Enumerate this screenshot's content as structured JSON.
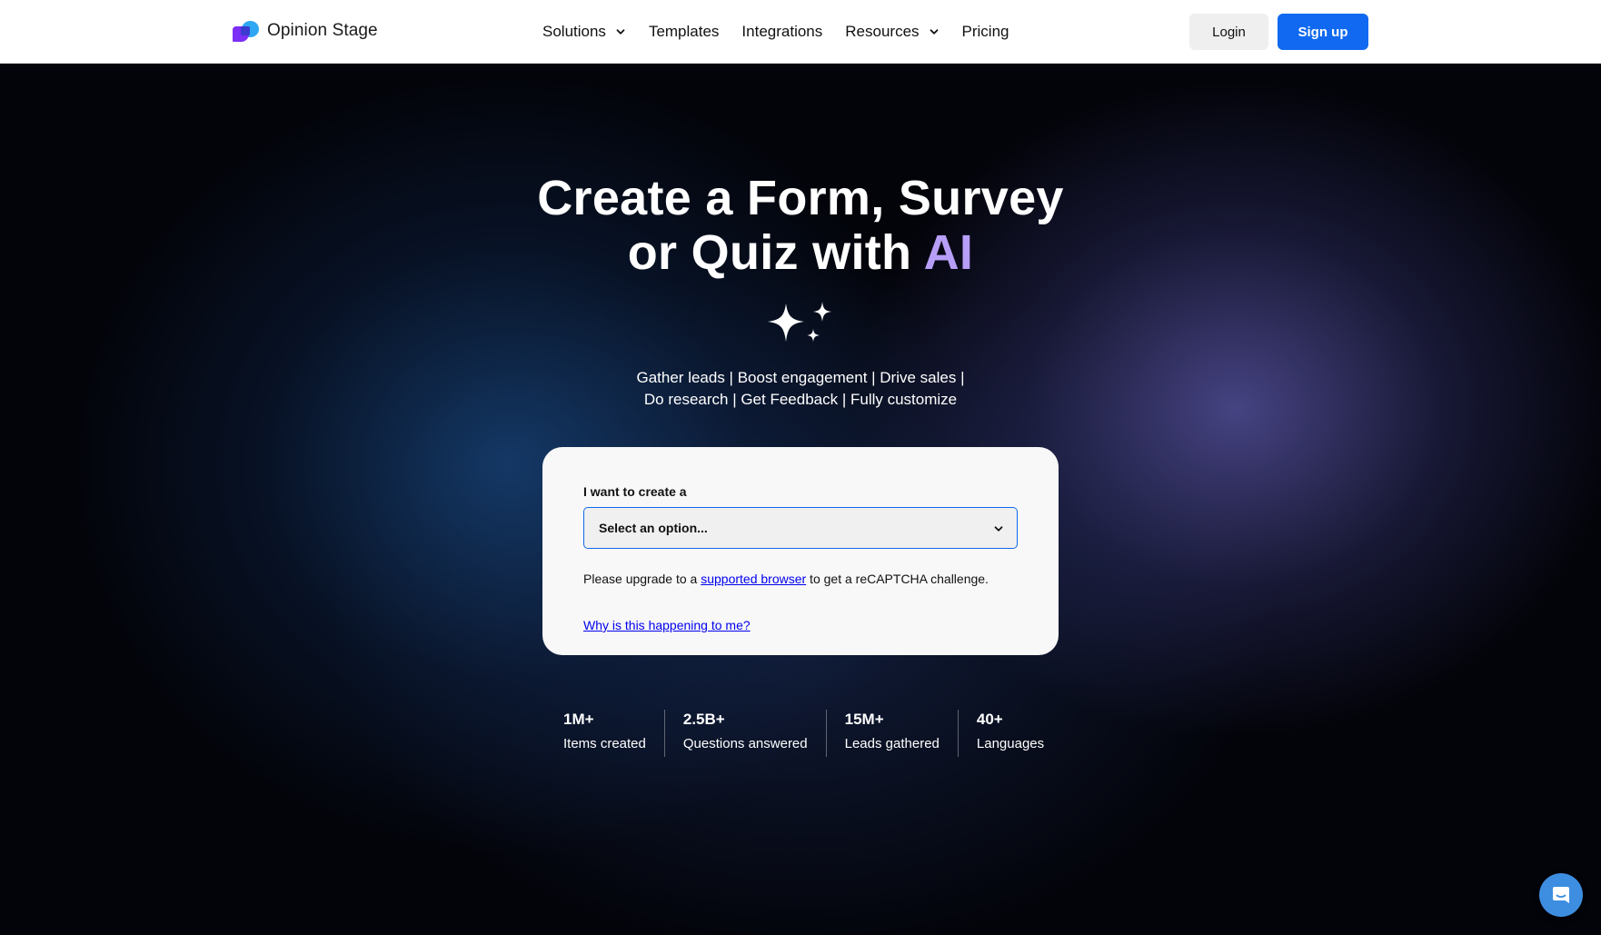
{
  "brand": {
    "name": "Opinion Stage",
    "accent": "#1069f0",
    "ai_color": "#b79ef7"
  },
  "nav": {
    "items": [
      {
        "label": "Solutions",
        "has_dropdown": true
      },
      {
        "label": "Templates",
        "has_dropdown": false
      },
      {
        "label": "Integrations",
        "has_dropdown": false
      },
      {
        "label": "Resources",
        "has_dropdown": true
      },
      {
        "label": "Pricing",
        "has_dropdown": false
      }
    ],
    "login": "Login",
    "signup": "Sign up"
  },
  "hero": {
    "title_line1": "Create a Form, Survey",
    "title_line2_prefix": "or Quiz with ",
    "title_highlight": "AI",
    "sparkle_icon": "sparkles-icon",
    "tagline_line1": "Gather leads | Boost engagement | Drive sales |",
    "tagline_line2": "Do research | Get Feedback | Fully customize"
  },
  "form": {
    "label": "I want to create a",
    "select_value": "Select an option...",
    "captcha_prefix": "Please upgrade to a ",
    "captcha_link": "supported browser",
    "captcha_suffix": " to get a reCAPTCHA challenge.",
    "why_link": "Why is this happening to me?"
  },
  "stats": [
    {
      "value": "1M+",
      "label": "Items created"
    },
    {
      "value": "2.5B+",
      "label": "Questions answered"
    },
    {
      "value": "15M+",
      "label": "Leads gathered"
    },
    {
      "value": "40+",
      "label": "Languages"
    }
  ],
  "chat_widget": {
    "icon": "chat-icon"
  }
}
